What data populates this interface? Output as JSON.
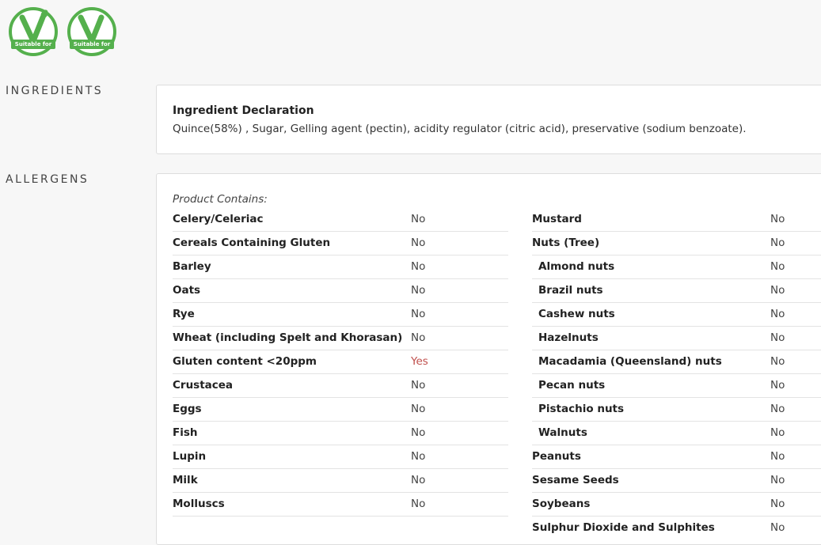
{
  "badges": [
    {
      "icon": "vegetarian-v-icon",
      "label": "Suitable for",
      "color": "#55b04d"
    },
    {
      "icon": "vegetarian-v-icon",
      "label": "Suitable for",
      "color": "#55b04d"
    }
  ],
  "ingredients": {
    "section_label": "INGREDIENTS",
    "title": "Ingredient Declaration",
    "text": "Quince(58%) , Sugar, Gelling agent (pectin), acidity regulator (citric acid), preservative (sodium benzoate)."
  },
  "allergens": {
    "section_label": "ALLERGENS",
    "contains_label": "Product Contains:",
    "left": [
      {
        "name": "Celery/Celeriac",
        "value": "No"
      },
      {
        "name": "Cereals Containing Gluten",
        "value": "No"
      },
      {
        "name": "Barley",
        "value": "No"
      },
      {
        "name": "Oats",
        "value": "No"
      },
      {
        "name": "Rye",
        "value": "No"
      },
      {
        "name": "Wheat (including Spelt and Khorasan)",
        "value": "No"
      },
      {
        "name": "Gluten content <20ppm",
        "value": "Yes"
      },
      {
        "name": "Crustacea",
        "value": "No"
      },
      {
        "name": "Eggs",
        "value": "No"
      },
      {
        "name": "Fish",
        "value": "No"
      },
      {
        "name": "Lupin",
        "value": "No"
      },
      {
        "name": "Milk",
        "value": "No"
      },
      {
        "name": "Molluscs",
        "value": "No"
      }
    ],
    "right": [
      {
        "name": "Mustard",
        "value": "No"
      },
      {
        "name": "Nuts (Tree)",
        "value": "No"
      },
      {
        "name": "Almond nuts",
        "value": "No",
        "sub": true
      },
      {
        "name": "Brazil nuts",
        "value": "No",
        "sub": true
      },
      {
        "name": "Cashew nuts",
        "value": "No",
        "sub": true
      },
      {
        "name": "Hazelnuts",
        "value": "No",
        "sub": true
      },
      {
        "name": "Macadamia (Queensland) nuts",
        "value": "No",
        "sub": true
      },
      {
        "name": "Pecan nuts",
        "value": "No",
        "sub": true
      },
      {
        "name": "Pistachio nuts",
        "value": "No",
        "sub": true
      },
      {
        "name": "Walnuts",
        "value": "No",
        "sub": true
      },
      {
        "name": "Peanuts",
        "value": "No"
      },
      {
        "name": "Sesame Seeds",
        "value": "No"
      },
      {
        "name": "Soybeans",
        "value": "No"
      },
      {
        "name": "Sulphur Dioxide and Sulphites",
        "value": "No"
      }
    ]
  }
}
